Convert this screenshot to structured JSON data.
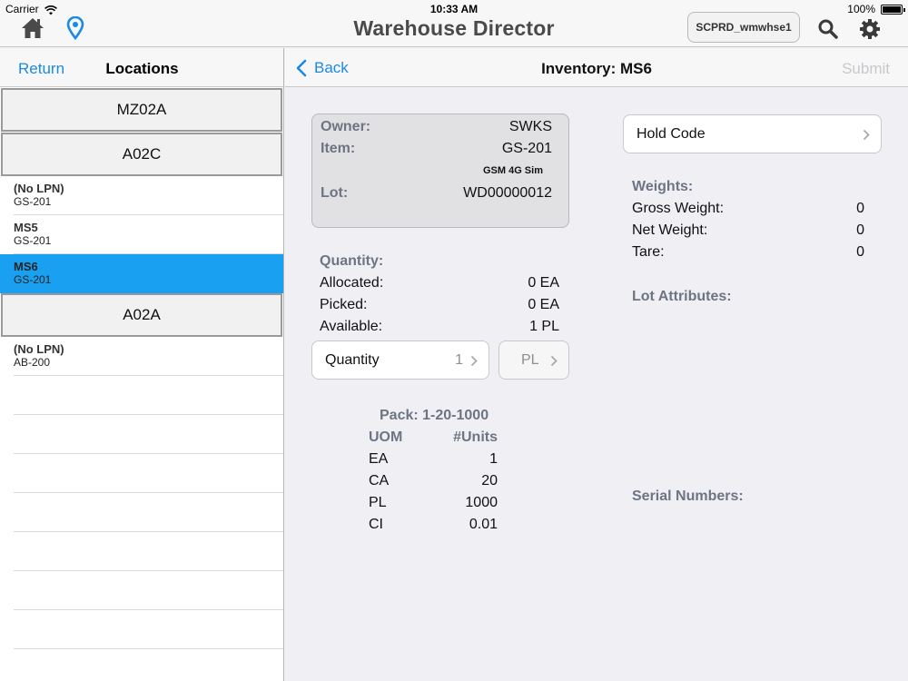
{
  "status_bar": {
    "carrier": "Carrier",
    "time": "10:33 AM",
    "battery": "100%"
  },
  "app": {
    "title": "Warehouse Director",
    "warehouse_button": "SCPRD_wmwhse1"
  },
  "icons": {
    "home": "home-icon",
    "location": "location-pin-icon",
    "search": "search-icon",
    "settings": "gear-icon",
    "wifi": "wifi-icon",
    "battery": "battery-icon"
  },
  "colors": {
    "accent": "#1a8ae4",
    "selected_row": "#1aa0f0",
    "label_gray": "#6d7583"
  },
  "left_panel": {
    "return_label": "Return",
    "title": "Locations",
    "group1": "MZ02A",
    "group2": "A02C",
    "items_a02c": [
      {
        "name": "(No LPN)",
        "sub": "GS-201"
      },
      {
        "name": "MS5",
        "sub": "GS-201"
      },
      {
        "name": "MS6",
        "sub": "GS-201"
      }
    ],
    "group3": "A02A",
    "items_a02a": [
      {
        "name": "(No LPN)",
        "sub": "AB-200"
      }
    ]
  },
  "right_panel": {
    "back_label": "Back",
    "title": "Inventory: MS6",
    "submit_label": "Submit",
    "owner_label": "Owner:",
    "owner_value": "SWKS",
    "item_label": "Item:",
    "item_value": "GS-201",
    "item_desc": "GSM 4G Sim",
    "lot_label": "Lot:",
    "lot_value": "WD00000012",
    "quantity_header": "Quantity:",
    "allocated_label": "Allocated:",
    "allocated_value": "0 EA",
    "picked_label": "Picked:",
    "picked_value": "0 EA",
    "available_label": "Available:",
    "available_value": "1 PL",
    "qty_field_label": "Quantity",
    "qty_field_value": "1",
    "uom_field_value": "PL",
    "pack_title": "Pack: 1-20-1000",
    "uom_header": "UOM",
    "units_header": "#Units",
    "pack_rows": [
      {
        "uom": "EA",
        "units": "1"
      },
      {
        "uom": "CA",
        "units": "20"
      },
      {
        "uom": "PL",
        "units": "1000"
      },
      {
        "uom": "CI",
        "units": "0.01"
      }
    ],
    "hold_code_label": "Hold Code",
    "weights_header": "Weights:",
    "gross_label": "Gross Weight:",
    "gross_value": "0",
    "net_label": "Net Weight:",
    "net_value": "0",
    "tare_label": "Tare:",
    "tare_value": "0",
    "lot_attributes_header": "Lot Attributes:",
    "serial_numbers_header": "Serial Numbers:"
  }
}
